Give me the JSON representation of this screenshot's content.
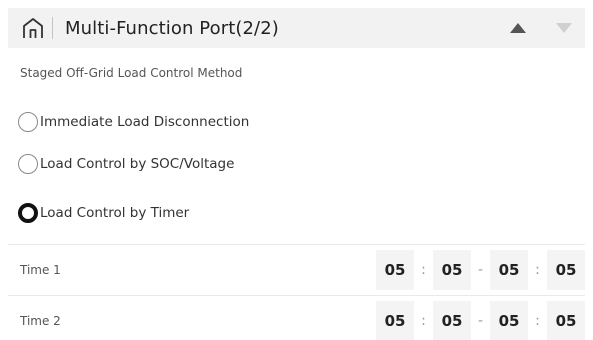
{
  "header": {
    "title": "Multi-Function Port(2/2)",
    "home_icon": "home-icon",
    "up_icon": "triangle-up-icon",
    "down_icon": "triangle-down-icon"
  },
  "section": {
    "label": "Staged Off-Grid Load Control Method"
  },
  "options": [
    {
      "label": "Immediate Load Disconnection",
      "selected": false
    },
    {
      "label": "Load Control by SOC/Voltage",
      "selected": false
    },
    {
      "label": "Load Control by Timer",
      "selected": true
    }
  ],
  "times": [
    {
      "label": "Time 1",
      "start_h": "05",
      "start_m": "05",
      "end_h": "05",
      "end_m": "05"
    },
    {
      "label": "Time 2",
      "start_h": "05",
      "start_m": "05",
      "end_h": "05",
      "end_m": "05"
    }
  ],
  "separators": {
    "colon": ":",
    "dash": "-"
  },
  "colors": {
    "header_bg": "#f2f2f2",
    "up_arrow": "#555555",
    "down_arrow": "#d0d0d0",
    "selected_radio": "#111111"
  }
}
